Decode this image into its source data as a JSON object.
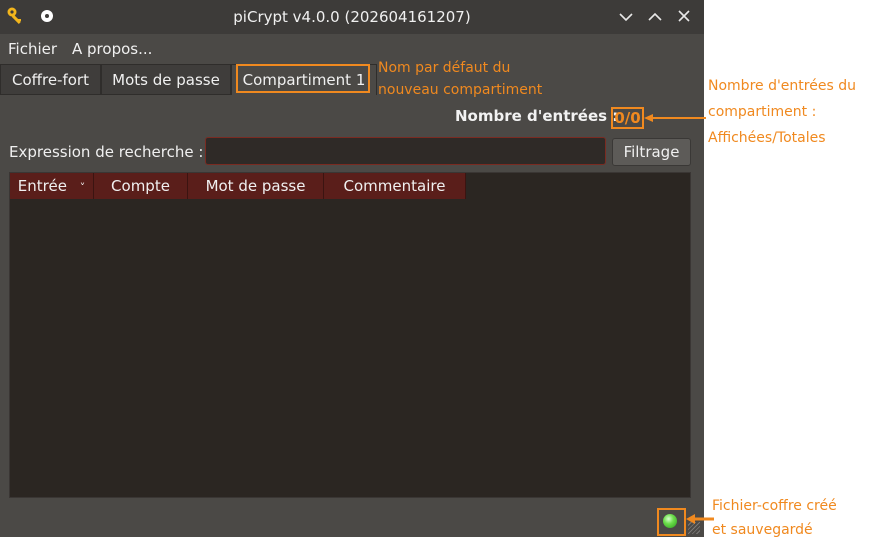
{
  "window": {
    "title": "piCrypt v4.0.0 (202604161207)"
  },
  "icons": {
    "app": "key-icon",
    "pin": "pin-icon",
    "minimize": "chevron-down-icon",
    "maximize": "chevron-up-icon",
    "close": "close-icon"
  },
  "menu": {
    "items": [
      "Fichier",
      "A propos..."
    ]
  },
  "tabs": [
    {
      "label": "Coffre-fort",
      "active": false
    },
    {
      "label": "Mots de passe",
      "active": false
    },
    {
      "label": "Compartiment 1",
      "active": true
    }
  ],
  "entries": {
    "label": "Nombre d'entrées :",
    "value": "0/0"
  },
  "search": {
    "label": "Expression de recherche :",
    "value": "",
    "button": "Filtrage"
  },
  "table": {
    "columns": [
      "Entrée",
      "Compte",
      "Mot de passe",
      "Commentaire"
    ],
    "sort_indicator": "˅",
    "rows": []
  },
  "status": {
    "indicator": "green",
    "tooltip": ""
  },
  "annotations": {
    "tab_note": [
      "Nom par défaut du",
      "nouveau compartiment"
    ],
    "count_note": [
      "Nombre d'entrées du",
      "compartiment :",
      "Affichées/Totales"
    ],
    "status_note": [
      "Fichier-coffre créé",
      "et sauvegardé"
    ]
  },
  "colors": {
    "annotation": "#f0891f",
    "header": "#5a1e1a",
    "status_led": "#4ccf34"
  }
}
